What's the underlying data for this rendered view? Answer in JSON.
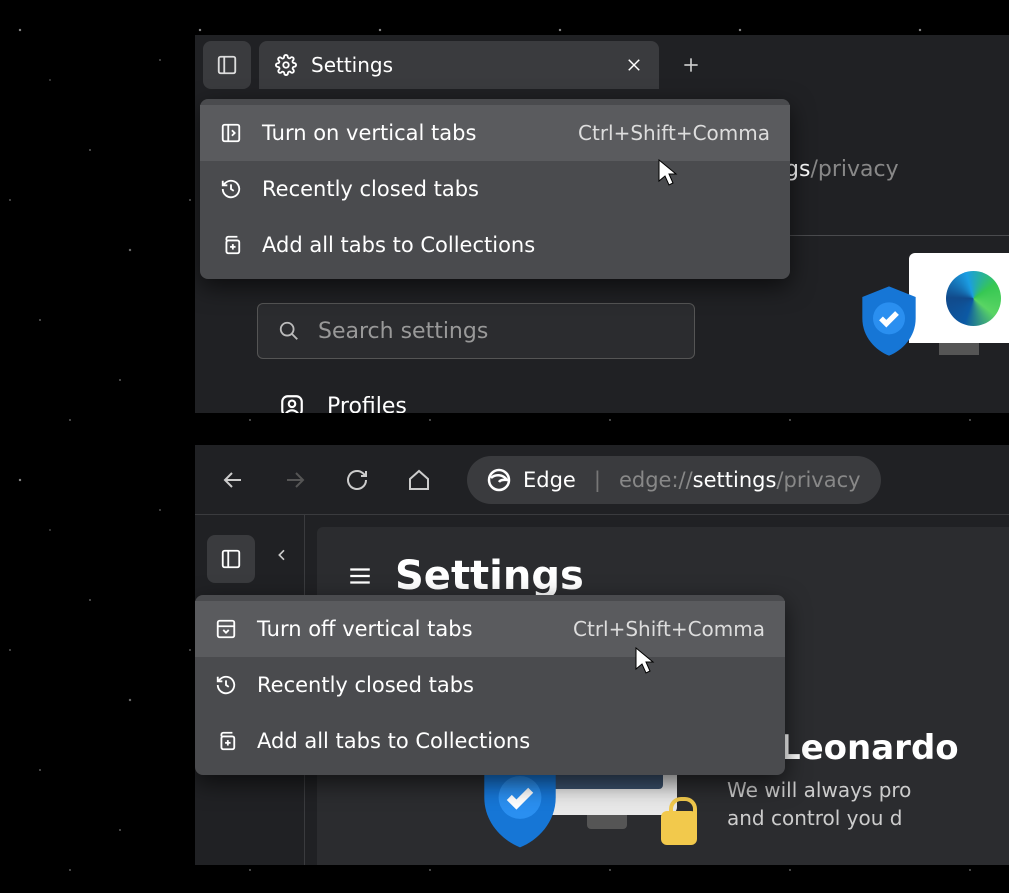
{
  "top": {
    "tab": {
      "title": "Settings"
    },
    "address_visible": {
      "suffix": "ings",
      "path": "/privacy"
    },
    "context_menu": {
      "items": [
        {
          "label": "Turn on vertical tabs",
          "shortcut": "Ctrl+Shift+Comma"
        },
        {
          "label": "Recently closed tabs"
        },
        {
          "label": "Add all tabs to Collections"
        }
      ]
    },
    "search": {
      "placeholder": "Search settings"
    },
    "nav": {
      "profiles": "Profiles"
    }
  },
  "bottom": {
    "address": {
      "brand": "Edge",
      "scheme": "edge://",
      "path_bright": "settings",
      "path_dim": "/privacy"
    },
    "settings_title": "Settings",
    "context_menu": {
      "items": [
        {
          "label": "Turn off vertical tabs",
          "shortcut": "Ctrl+Shift+Comma"
        },
        {
          "label": "Recently closed tabs"
        },
        {
          "label": "Add all tabs to Collections"
        }
      ]
    },
    "promo": {
      "heading": "Hi Leonardo",
      "line1": "We will always pro",
      "line2": "and control you d"
    }
  }
}
